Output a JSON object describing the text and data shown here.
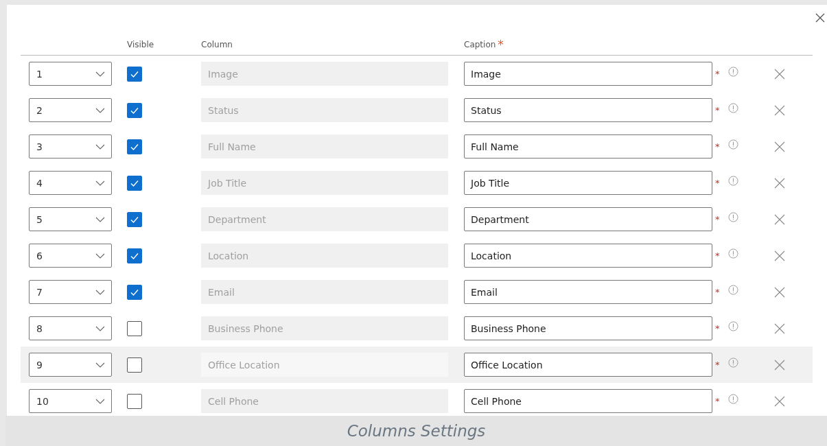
{
  "dialog": {
    "footer_caption": "Columns Settings"
  },
  "table": {
    "columns": [
      "Visible",
      "Column",
      "Caption"
    ],
    "caption_required_mark": "*",
    "rows": [
      {
        "order": "1",
        "visible": true,
        "column": "Image",
        "caption": "Image",
        "highlighted": false
      },
      {
        "order": "2",
        "visible": true,
        "column": "Status",
        "caption": "Status",
        "highlighted": false
      },
      {
        "order": "3",
        "visible": true,
        "column": "Full Name",
        "caption": "Full Name",
        "highlighted": false
      },
      {
        "order": "4",
        "visible": true,
        "column": "Job Title",
        "caption": "Job Title",
        "highlighted": false
      },
      {
        "order": "5",
        "visible": true,
        "column": "Department",
        "caption": "Department",
        "highlighted": false
      },
      {
        "order": "6",
        "visible": true,
        "column": "Location",
        "caption": "Location",
        "highlighted": false
      },
      {
        "order": "7",
        "visible": true,
        "column": "Email",
        "caption": "Email",
        "highlighted": false
      },
      {
        "order": "8",
        "visible": false,
        "column": "Business Phone",
        "caption": "Business Phone",
        "highlighted": false
      },
      {
        "order": "9",
        "visible": false,
        "column": "Office Location",
        "caption": "Office Location",
        "highlighted": true
      },
      {
        "order": "10",
        "visible": false,
        "column": "Cell Phone",
        "caption": "Cell Phone",
        "highlighted": false
      }
    ]
  }
}
